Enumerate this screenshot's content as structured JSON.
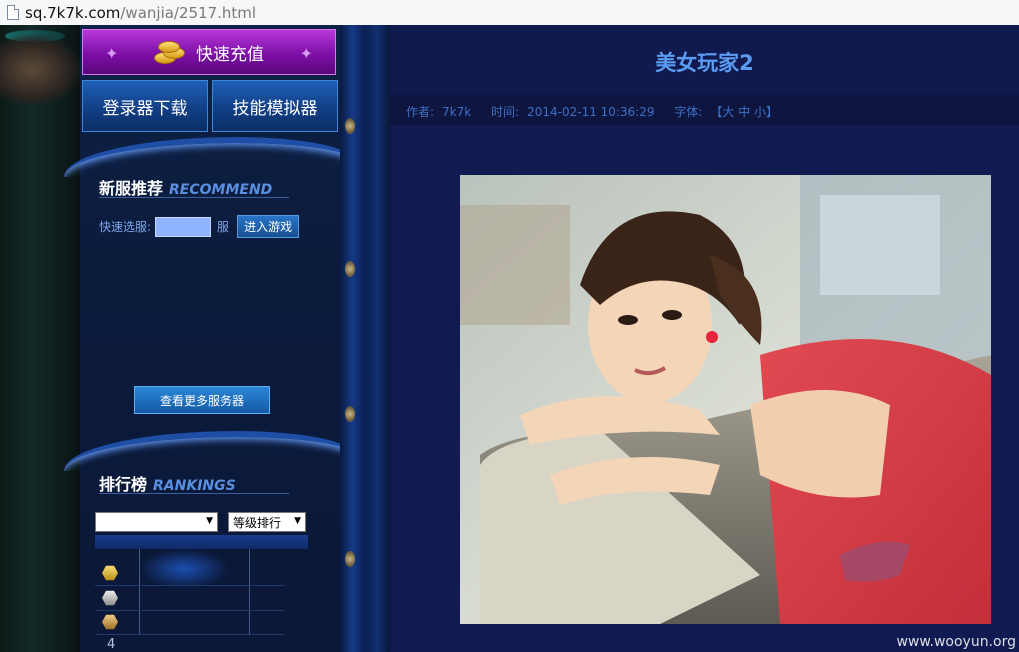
{
  "browser": {
    "url_host": "sq.7k7k.com",
    "url_path": "/wanjia/2517.html"
  },
  "sidebar": {
    "recharge_label": "快速充值",
    "buttons": [
      {
        "label": "登录器下载"
      },
      {
        "label": "技能模拟器"
      }
    ],
    "recommend": {
      "title_cn": "新服推荐",
      "title_en": "RECOMMEND",
      "quick_label": "快速选服:",
      "server_value": "",
      "server_unit": "服",
      "enter_button": "进入游戏",
      "more_button": "查看更多服务器"
    },
    "rankings": {
      "title_cn": "排行榜",
      "title_en": "RANKINGS",
      "select_left": "",
      "select_right": "等级排行",
      "rows": [
        {
          "rank_icon": "gold-medal-icon"
        },
        {
          "rank_icon": "silver-medal-icon"
        },
        {
          "rank_icon": "bronze-medal-icon"
        }
      ],
      "next_rank": "4"
    }
  },
  "article": {
    "title": "美女玩家2",
    "author_label": "作者:",
    "author": "7k7k",
    "time_label": "时间:",
    "time": "2014-02-11 10:36:29",
    "font_label": "字体:",
    "font_sizes": "【大 中 小】"
  },
  "watermark": "www.wooyun.org"
}
